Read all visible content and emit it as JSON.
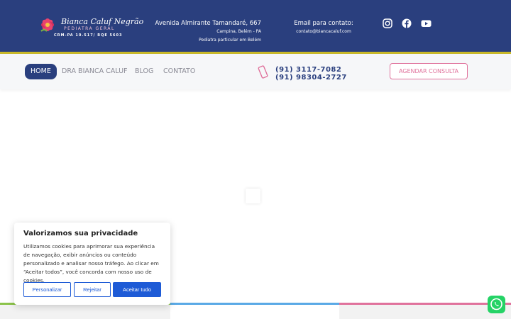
{
  "header": {
    "logo": {
      "name": "Bianca Caluf Negrão",
      "subtitle": "PEDIATRA GERAL",
      "crm": "CRM-PA 10.517/ RQE 5603"
    },
    "address": {
      "line1": "Avenida Almirante Tamandaré, 667",
      "line2": "Campina, Belém - PA",
      "line3": "Pediatra particular em Belém"
    },
    "contact": {
      "label": "Email para contato:",
      "email": "contato@biancacaluf.com"
    },
    "social": [
      "instagram-icon",
      "facebook-icon",
      "youtube-icon"
    ],
    "colors": {
      "primary": "#2a3f7e",
      "accent_line": "#c9b92a",
      "pink": "#e0729c"
    }
  },
  "nav": {
    "items": [
      {
        "label": "HOME",
        "active": true
      },
      {
        "label": "DRA BIANCA CALUF",
        "active": false
      },
      {
        "label": "BLOG",
        "active": false
      },
      {
        "label": "CONTATO",
        "active": false
      }
    ],
    "phones": [
      "(91) 3117-7082",
      "(91) 98304-2727"
    ],
    "cta": "AGENDAR CONSULTA"
  },
  "cookie": {
    "title": "Valorizamos sua privacidade",
    "text": "Utilizamos cookies para aprimorar sua experiência de navegação, exibir anúncios ou conteúdo personalizado e analisar nosso tráfego. Ao clicar em “Aceitar todos”, você concorda com nosso uso de cookies.",
    "buttons": {
      "customize": "Personalizar",
      "reject": "Rejeitar",
      "accept": "Aceitar tudo"
    },
    "button_color": "#1e5bd6"
  },
  "footer_stripes": [
    "#8bc34a",
    "#5aa9e6",
    "#e0729c"
  ]
}
